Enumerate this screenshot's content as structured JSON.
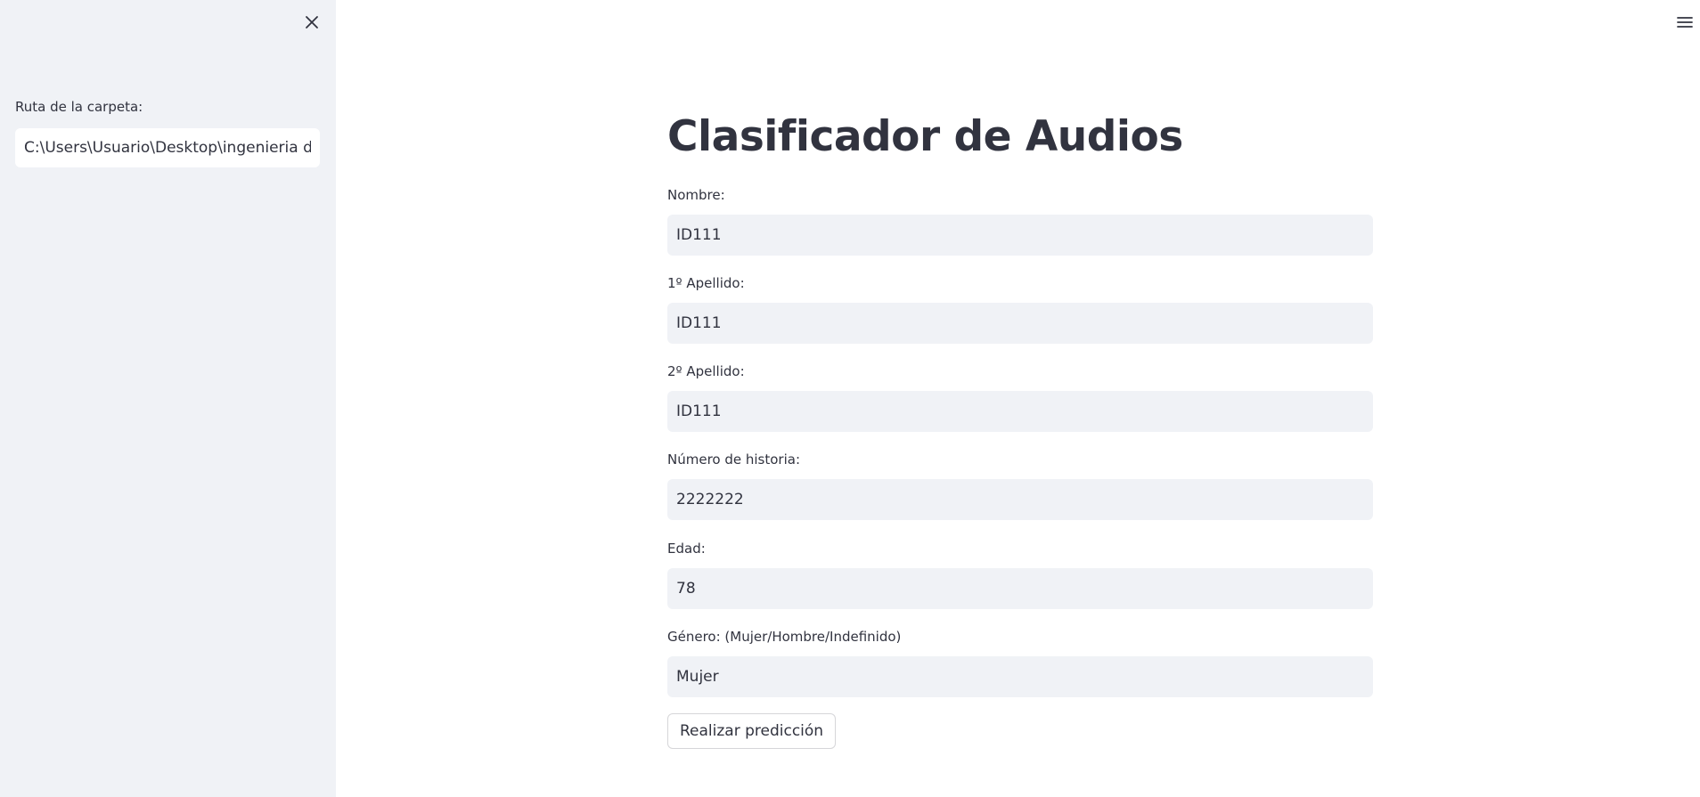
{
  "sidebar": {
    "close_icon": "close-icon",
    "folder_path_label": "Ruta de la carpeta:",
    "folder_path_value": "C:\\Users\\Usuario\\Desktop\\ingenieria de la s"
  },
  "header": {
    "menu_icon": "hamburger-menu-icon"
  },
  "main": {
    "title": "Clasificador de Audios",
    "fields": [
      {
        "label": "Nombre:",
        "value": "ID111"
      },
      {
        "label": "1º Apellido:",
        "value": "ID111"
      },
      {
        "label": "2º Apellido:",
        "value": "ID111"
      },
      {
        "label": "Número de historia:",
        "value": "2222222"
      },
      {
        "label": "Edad:",
        "value": "78"
      },
      {
        "label": "Género: (Mujer/Hombre/Indefinido)",
        "value": "Mujer"
      }
    ],
    "predict_button_label": "Realizar predicción"
  },
  "colors": {
    "sidebar_bg": "#f0f2f6",
    "input_bg": "#f0f2f6",
    "text": "#31333f"
  }
}
